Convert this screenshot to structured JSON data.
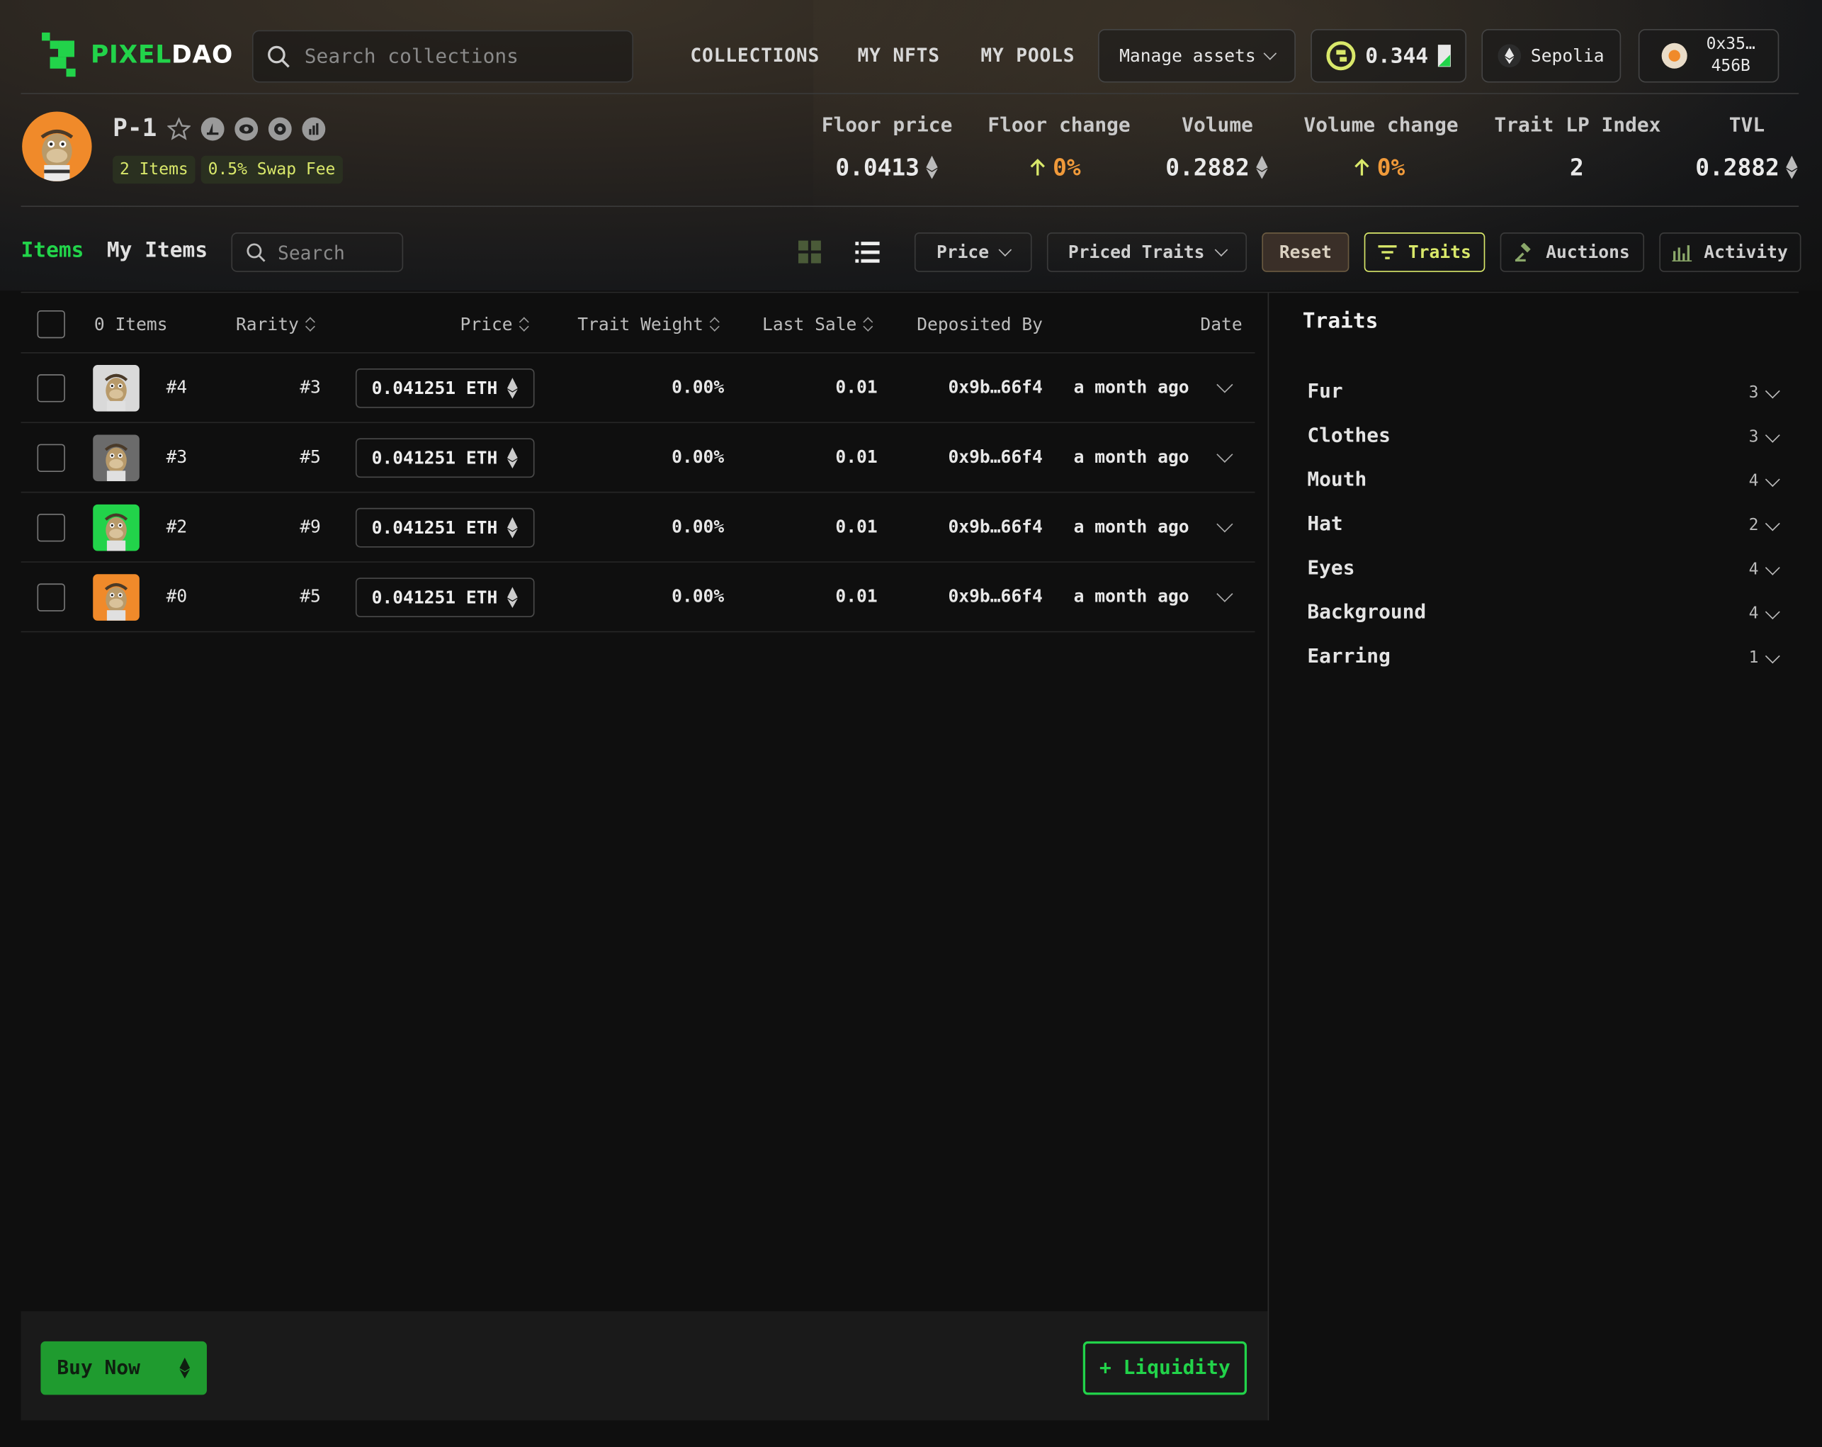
{
  "brand": {
    "logo_left": "PIXEL",
    "logo_right": "DAO"
  },
  "header": {
    "search_placeholder": "Search collections",
    "nav": [
      "COLLECTIONS",
      "MY NFTS",
      "MY POOLS"
    ],
    "manage_assets": "Manage assets",
    "balance": "0.344",
    "network": "Sepolia",
    "wallet_line1": "0x35…",
    "wallet_line2": "456B"
  },
  "collection": {
    "name": "P-1",
    "badge_items": "2 Items",
    "badge_fee": "0.5% Swap Fee",
    "stats": [
      {
        "label": "Floor price",
        "value": "0.0413"
      },
      {
        "label": "Floor change",
        "value": "0%"
      },
      {
        "label": "Volume",
        "value": "0.2882"
      },
      {
        "label": "Volume change",
        "value": "0%"
      },
      {
        "label": "Trait LP Index",
        "value": "2"
      },
      {
        "label": "TVL",
        "value": "0.2882"
      }
    ]
  },
  "filters": {
    "tab_items": "Items",
    "tab_my_items": "My Items",
    "search_placeholder": "Search",
    "price": "Price",
    "priced_traits": "Priced Traits",
    "reset": "Reset",
    "traits": "Traits",
    "auctions": "Auctions",
    "activity": "Activity"
  },
  "table": {
    "headers": {
      "items": "0 Items",
      "rarity": "Rarity",
      "price": "Price",
      "trait_weight": "Trait Weight",
      "last_sale": "Last Sale",
      "deposited_by": "Deposited By",
      "date": "Date"
    },
    "rows": [
      {
        "id": "#4",
        "rarity": "#3",
        "price": "0.041251 ETH",
        "trait_weight": "0.00%",
        "last_sale": "0.01",
        "deposited_by": "0x9b…66f4",
        "date": "a month ago",
        "thumb_bg": "#d9d9d9"
      },
      {
        "id": "#3",
        "rarity": "#5",
        "price": "0.041251 ETH",
        "trait_weight": "0.00%",
        "last_sale": "0.01",
        "deposited_by": "0x9b…66f4",
        "date": "a month ago",
        "thumb_bg": "#6b6b6b"
      },
      {
        "id": "#2",
        "rarity": "#9",
        "price": "0.041251 ETH",
        "trait_weight": "0.00%",
        "last_sale": "0.01",
        "deposited_by": "0x9b…66f4",
        "date": "a month ago",
        "thumb_bg": "#22d34a"
      },
      {
        "id": "#0",
        "rarity": "#5",
        "price": "0.041251 ETH",
        "trait_weight": "0.00%",
        "last_sale": "0.01",
        "deposited_by": "0x9b…66f4",
        "date": "a month ago",
        "thumb_bg": "#f08a2a"
      }
    ]
  },
  "traits_panel": {
    "title": "Traits",
    "items": [
      {
        "name": "Fur",
        "count": "3"
      },
      {
        "name": "Clothes",
        "count": "3"
      },
      {
        "name": "Mouth",
        "count": "4"
      },
      {
        "name": "Hat",
        "count": "2"
      },
      {
        "name": "Eyes",
        "count": "4"
      },
      {
        "name": "Background",
        "count": "4"
      },
      {
        "name": "Earring",
        "count": "1"
      }
    ]
  },
  "footer": {
    "buy_now": "Buy Now",
    "liquidity": "+ Liquidity"
  },
  "colors": {
    "accent": "#22d34a",
    "change": "#f09a3a",
    "badge_text": "#d9e86a"
  }
}
